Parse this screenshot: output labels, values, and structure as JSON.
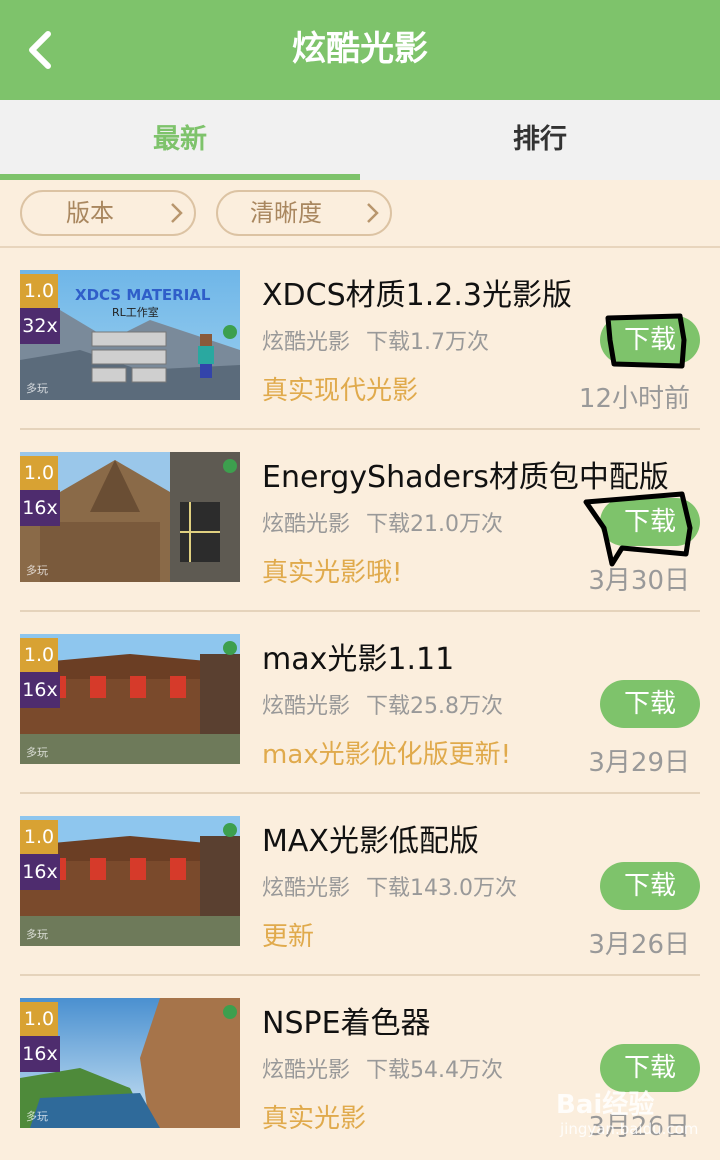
{
  "header": {
    "title": "炫酷光影"
  },
  "tabs": [
    {
      "label": "最新"
    },
    {
      "label": "排行"
    }
  ],
  "filters": [
    {
      "label": "版本"
    },
    {
      "label": "清晰度"
    }
  ],
  "items": [
    {
      "name": "XDCS材质1.2.3光影版",
      "version": "1.0",
      "resolution": "32x",
      "category": "炫酷光影",
      "downloads": "下载1.7万次",
      "desc": "真实现代光影",
      "date": "12小时前",
      "button": "下载",
      "thumb_title": "XDCS MATERIAL",
      "thumb_sub": "RL工作室"
    },
    {
      "name": "EnergyShaders材质包中配版",
      "version": "1.0",
      "resolution": "16x",
      "category": "炫酷光影",
      "downloads": "下载21.0万次",
      "desc": "真实光影哦!",
      "date": "3月30日",
      "button": "下载"
    },
    {
      "name": "max光影1.11",
      "version": "1.0",
      "resolution": "16x",
      "category": "炫酷光影",
      "downloads": "下载25.8万次",
      "desc": "max光影优化版更新!",
      "date": "3月29日",
      "button": "下载"
    },
    {
      "name": "MAX光影低配版",
      "version": "1.0",
      "resolution": "16x",
      "category": "炫酷光影",
      "downloads": "下载143.0万次",
      "desc": "更新",
      "date": "3月26日",
      "button": "下载"
    },
    {
      "name": "NSPE着色器",
      "version": "1.0",
      "resolution": "16x",
      "category": "炫酷光影",
      "downloads": "下载54.4万次",
      "desc": "真实光影",
      "date": "3月26日",
      "button": "下载"
    }
  ],
  "thumb_watermark": "多玩",
  "watermark": {
    "main": "Bai经验",
    "sub": "jingyan.baidu.com"
  },
  "colors": {
    "accent": "#7ec36b",
    "background": "#fbeedd",
    "highlight": "#e0aa4c",
    "version_badge": "#d8a233",
    "res_badge": "#4e2c6e"
  }
}
